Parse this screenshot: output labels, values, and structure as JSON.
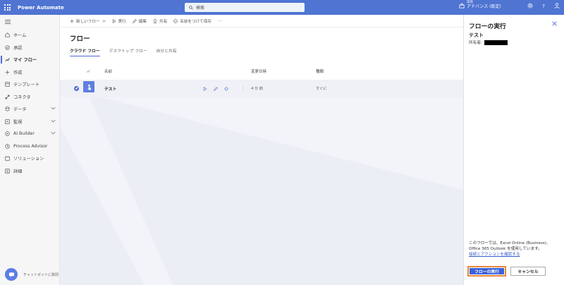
{
  "topbar": {
    "app_name": "Power Automate",
    "search_placeholder": "検索",
    "env_label": "環境",
    "env_value": "アドバンス (既定)"
  },
  "sidebar": {
    "items": [
      {
        "label": "ホーム",
        "icon": "home-icon"
      },
      {
        "label": "承認",
        "icon": "approval-icon"
      },
      {
        "label": "マイ フロー",
        "icon": "flow-icon",
        "active": true
      },
      {
        "label": "作成",
        "icon": "plus-icon"
      },
      {
        "label": "テンプレート",
        "icon": "template-icon"
      },
      {
        "label": "コネクタ",
        "icon": "connector-icon"
      },
      {
        "label": "データ",
        "icon": "data-icon",
        "expandable": true
      },
      {
        "label": "監視",
        "icon": "monitor-icon",
        "expandable": true
      },
      {
        "label": "AI Builder",
        "icon": "ai-icon",
        "expandable": true
      },
      {
        "label": "Process Advisor",
        "icon": "process-icon"
      },
      {
        "label": "ソリューション",
        "icon": "solution-icon"
      },
      {
        "label": "詳細",
        "icon": "more-icon"
      }
    ],
    "chatbot_label": "チャットボットに質問"
  },
  "toolbar": {
    "new_flow": "新しいフロー",
    "run": "実行",
    "edit": "編集",
    "share": "共有",
    "save_as": "名前をつけて保存",
    "more": "···"
  },
  "main": {
    "title": "フロー",
    "tabs": [
      {
        "label": "クラウド フロー",
        "active": true
      },
      {
        "label": "デスクトップ フロー"
      },
      {
        "label": "自分と共有"
      }
    ],
    "columns": {
      "name": "名前",
      "modified": "変更日時",
      "type": "種類"
    },
    "rows": [
      {
        "name": "テスト",
        "modified": "4 分 前",
        "type": "すぐに"
      }
    ]
  },
  "panel": {
    "title": "フローの実行",
    "flow_name": "テスト",
    "owner_label": "所有者:",
    "description": "このフローでは、Excel Online (Business)、Office 365 Outlook を使用しています。",
    "link": "接続とアクションを確認する",
    "run_button": "フローの実行",
    "cancel_button": "キャンセル"
  },
  "colors": {
    "brand": "#4f74d2",
    "primary_button": "#3a62d8",
    "highlight": "#e8863a"
  }
}
